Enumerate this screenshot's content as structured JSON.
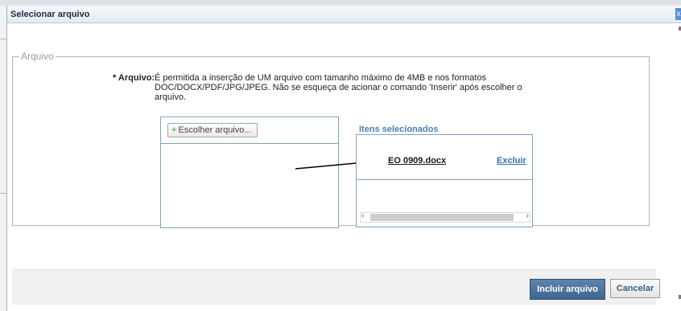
{
  "dialog": {
    "title": "Selecionar arquivo",
    "close_label": "x"
  },
  "fieldset": {
    "legend": "Arquivo",
    "field_label": "* Arquivo:",
    "description": "É permitida a inserção de UM arquivo com tamanho máximo de 4MB e nos formatos DOC/DOCX/PDF/JPG/JPEG. Não se esqueça de acionar o comando 'Inserir' após escolher o arquivo."
  },
  "upload": {
    "choose_label": "Escolher arquivo...",
    "selected_title": "Itens selecionados",
    "selected_items": [
      {
        "name": "EO 0909.docx",
        "action": "Excluir"
      }
    ]
  },
  "footer": {
    "include_label": "Incluir arquivo",
    "cancel_label": "Cancelar"
  },
  "colors": {
    "accent": "#4d7fae",
    "primary_button": "#4a6f98",
    "link": "#3b6ea5"
  }
}
